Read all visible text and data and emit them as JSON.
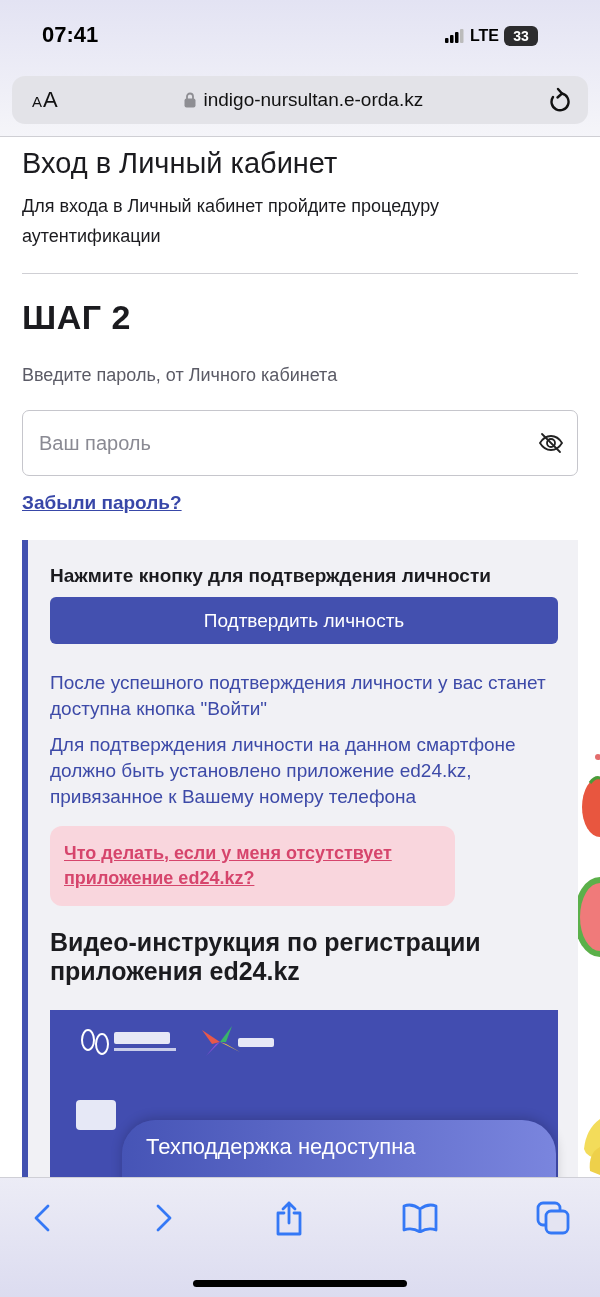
{
  "status_bar": {
    "time": "07:41",
    "network": "LTE",
    "battery": "33"
  },
  "address_bar": {
    "text_size_label": "AA",
    "url": "indigo-nursultan.e-orda.kz"
  },
  "page": {
    "title": "Вход в Личный кабинет",
    "subtitle": "Для входа в Личный кабинет пройдите процедуру аутентификации",
    "step": "ШАГ 2",
    "password_label": "Введите пароль, от Личного кабинета",
    "password_field": {
      "placeholder": "Ваш пароль",
      "masked": true
    },
    "forgot_link": "Забыли пароль?",
    "card": {
      "heading": "Нажмите кнопку для подтверждения личности",
      "button": "Подтвердить личность",
      "notes": [
        "После успешного подтверждения личности у вас станет доступна кнопка \"Войти\"",
        "Для подтверждения личности на данном смартфоне должно быть установлено приложение ed24.kz, привязанное к Вашему номеру телефона"
      ],
      "help_link": "Что делать, если у меня отсутствует приложение ed24.kz?",
      "video_heading": "Видео-инструкция по регистрации приложения ed24.kz"
    }
  },
  "support_toast": {
    "text": "Техподдержка недоступна"
  }
}
